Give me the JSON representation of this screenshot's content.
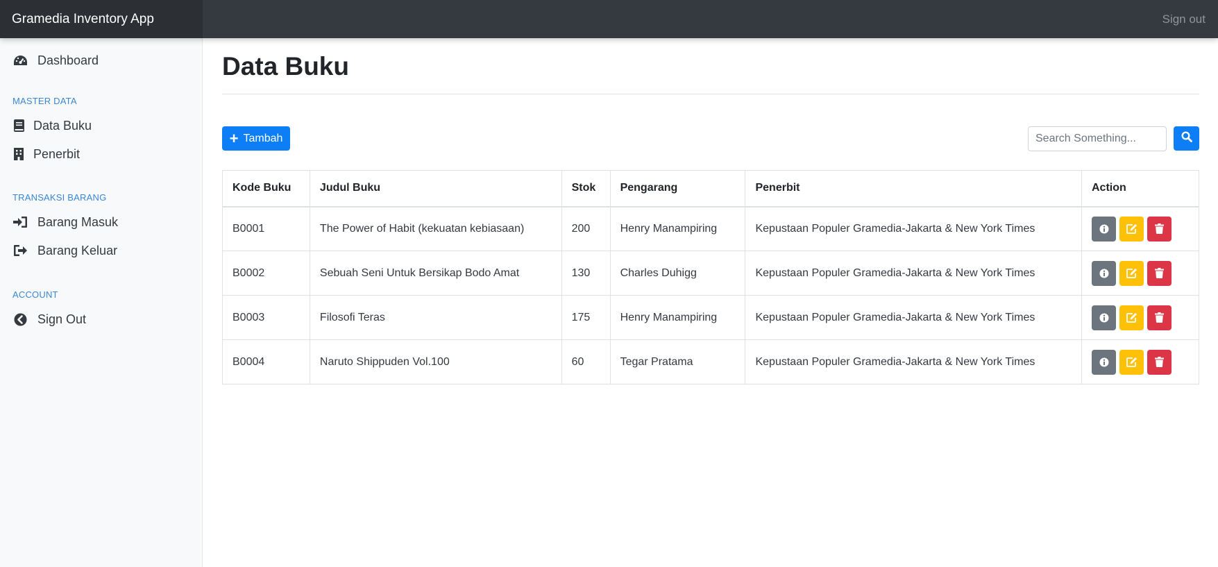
{
  "app": {
    "brand": "Gramedia Inventory App",
    "signout_label": "Sign out"
  },
  "sidebar": {
    "dashboard": {
      "label": "Dashboard",
      "icon": "dashboard-gauge-icon"
    },
    "sections": [
      {
        "heading": "MASTER DATA",
        "items": [
          {
            "label": "Data Buku",
            "icon": "book-icon"
          },
          {
            "label": "Penerbit",
            "icon": "building-icon"
          }
        ]
      },
      {
        "heading": "TRANSAKSI BARANG",
        "items": [
          {
            "label": "Barang Masuk",
            "icon": "sign-in-icon"
          },
          {
            "label": "Barang Keluar",
            "icon": "sign-out-icon"
          }
        ]
      },
      {
        "heading": "ACCOUNT",
        "items": [
          {
            "label": "Sign Out",
            "icon": "chevron-circle-left-icon"
          }
        ]
      }
    ]
  },
  "page": {
    "title": "Data Buku",
    "add_button": "Tambah",
    "search_placeholder": "Search Something..."
  },
  "table": {
    "headers": [
      "Kode Buku",
      "Judul Buku",
      "Stok",
      "Pengarang",
      "Penerbit",
      "Action"
    ],
    "rows": [
      {
        "kode": "B0001",
        "judul": "The Power of Habit (kekuatan kebiasaan)",
        "stok": "200",
        "pengarang": "Henry Manampiring",
        "penerbit": "Kepustaan Populer Gramedia-Jakarta & New York Times"
      },
      {
        "kode": "B0002",
        "judul": "Sebuah Seni Untuk Bersikap Bodo Amat",
        "stok": "130",
        "pengarang": "Charles Duhigg",
        "penerbit": "Kepustaan Populer Gramedia-Jakarta & New York Times"
      },
      {
        "kode": "B0003",
        "judul": "Filosofi Teras",
        "stok": "175",
        "pengarang": "Henry Manampiring",
        "penerbit": "Kepustaan Populer Gramedia-Jakarta & New York Times"
      },
      {
        "kode": "B0004",
        "judul": "Naruto Shippuden Vol.100",
        "stok": "60",
        "pengarang": "Tegar Pratama",
        "penerbit": "Kepustaan Populer Gramedia-Jakarta & New York Times"
      }
    ]
  },
  "colors": {
    "topbar": "#343a40",
    "primary": "#0d7ef5",
    "info": "#6c757d",
    "warning": "#ffc107",
    "danger": "#dc3545",
    "section_heading": "#3a86d4"
  }
}
